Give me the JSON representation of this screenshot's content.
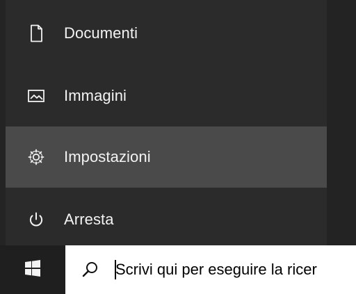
{
  "menu": {
    "items": [
      {
        "label": "Documenti",
        "icon": "document-icon"
      },
      {
        "label": "Immagini",
        "icon": "image-icon"
      },
      {
        "label": "Impostazioni",
        "icon": "gear-icon"
      },
      {
        "label": "Arresta",
        "icon": "power-icon"
      }
    ],
    "active_index": 2
  },
  "taskbar": {
    "start_icon": "windows-logo-icon",
    "search_icon": "search-icon",
    "search_text": "Scrivi qui per eseguire la ricer"
  },
  "colors": {
    "menu_background": "#2b2b2b",
    "hover_background": "#4a4a4a",
    "taskbar_background": "#1f1f1f",
    "search_background": "#ffffff",
    "text_light": "#f3f3f3",
    "text_dark": "#000000"
  }
}
